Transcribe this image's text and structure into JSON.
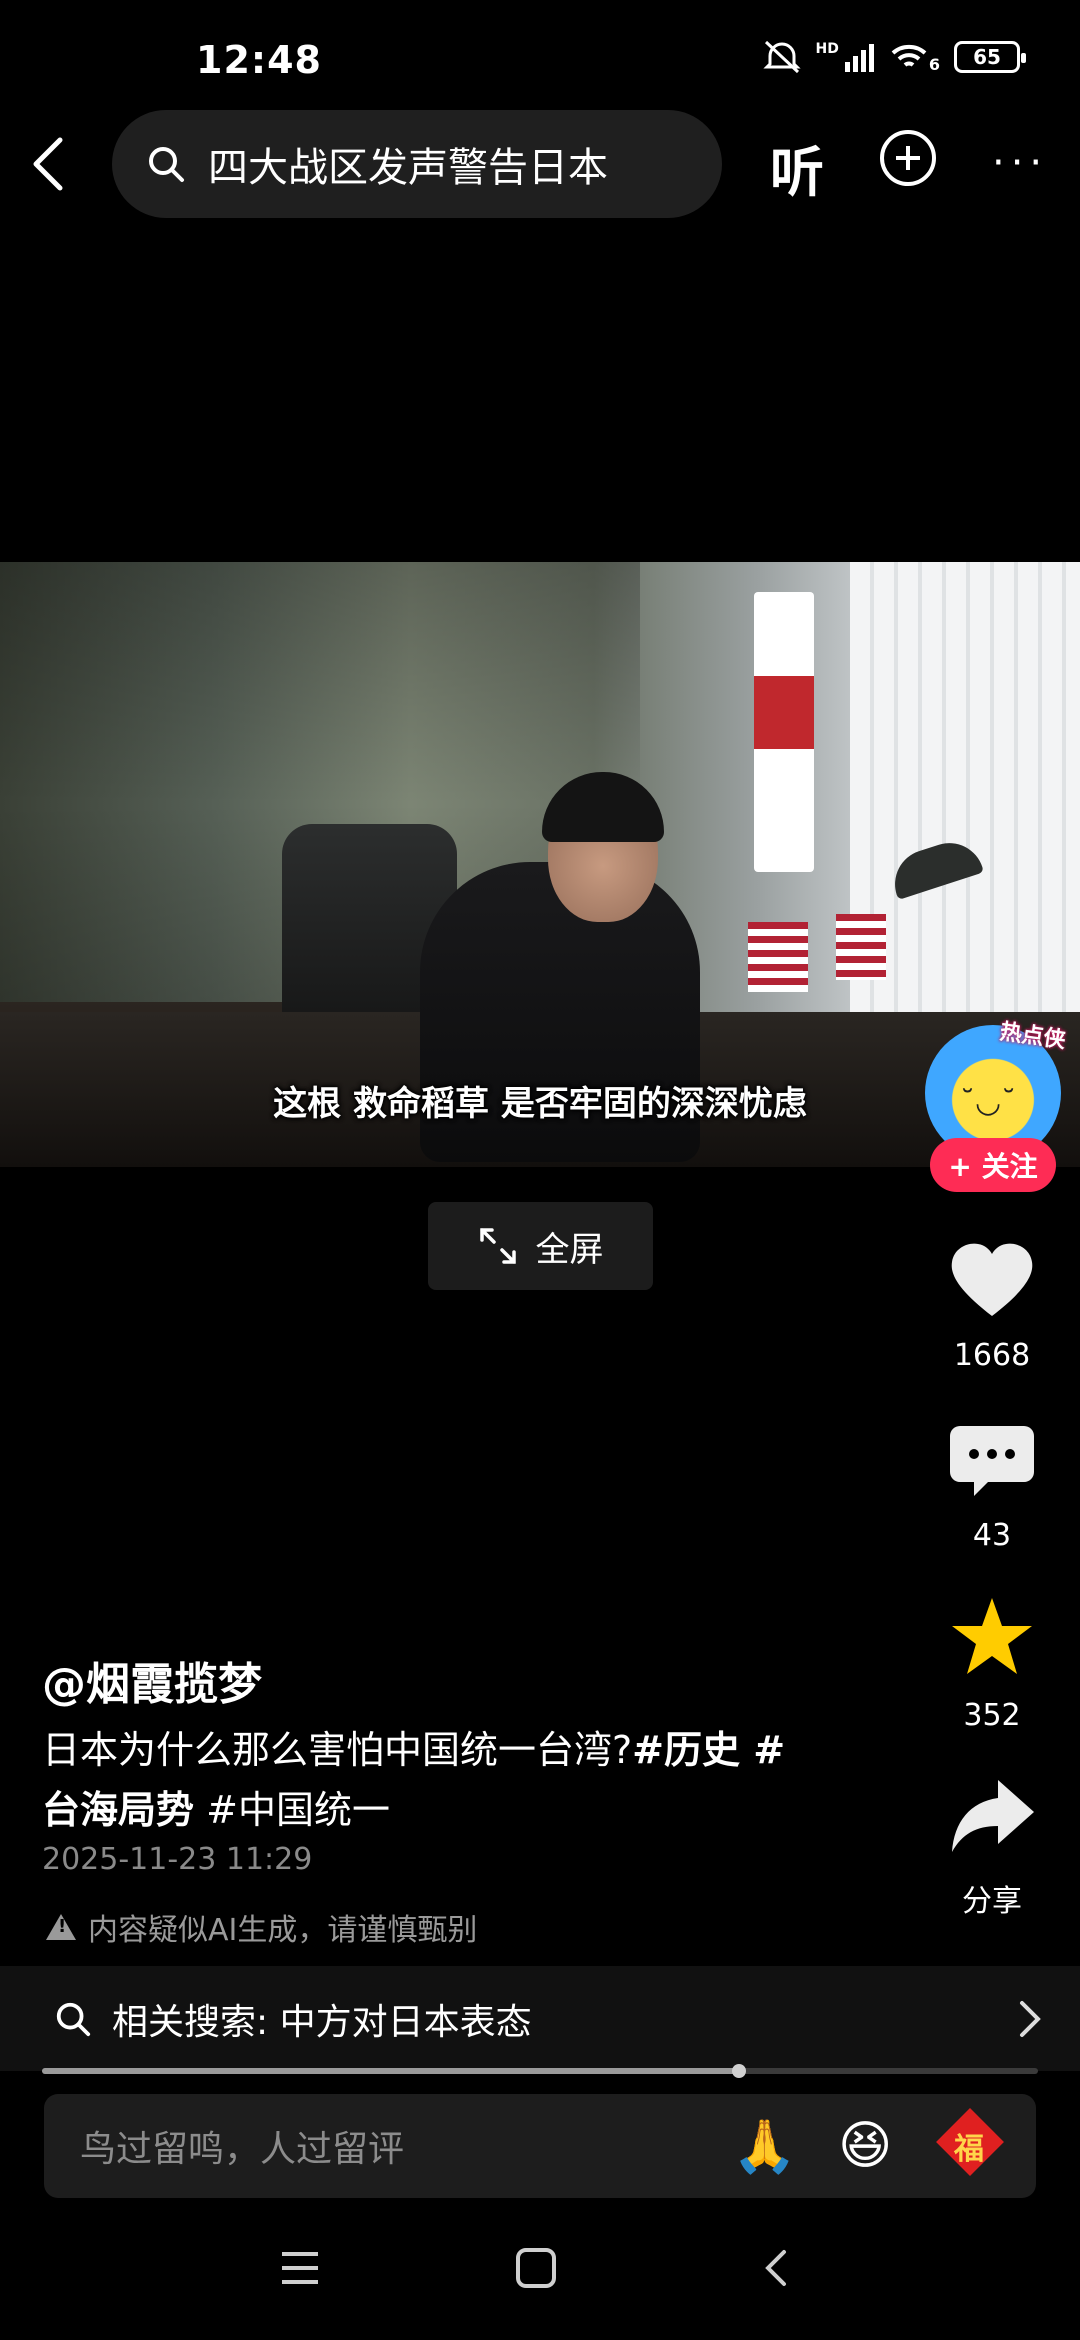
{
  "status_bar": {
    "time": "12:48",
    "net_label": "HD",
    "wifi_label": "6",
    "battery": "65"
  },
  "top_bar": {
    "search_query": "四大战区发声警告日本",
    "listen_label": "听"
  },
  "video": {
    "subtitle": "这根 救命稻草 是否牢固的深深忧虑",
    "fullscreen_label": "全屏",
    "follow_label": "+ 关注",
    "avatar_text": "热点侠"
  },
  "actions": {
    "likes": "1668",
    "comments": "43",
    "favorites": "352",
    "share_label": "分享"
  },
  "post": {
    "author": "@烟霞揽梦",
    "desc_text": "日本为什么那么害怕中国统一台湾?",
    "tag1": "#历史 #",
    "tag2": "台海局势",
    "tag3": "#中国统一",
    "date": "2025-11-23 11:29",
    "ai_notice": "内容疑似AI生成，请谨慎甄别"
  },
  "related": {
    "text": "相关搜索: 中方对日本表态"
  },
  "playback": {
    "progress": 0.7
  },
  "comment_bar": {
    "placeholder": "鸟过留鸣，人过留评",
    "fu_label": "福"
  },
  "colors": {
    "accent": "#fe2c55",
    "star": "#ffcc00"
  }
}
